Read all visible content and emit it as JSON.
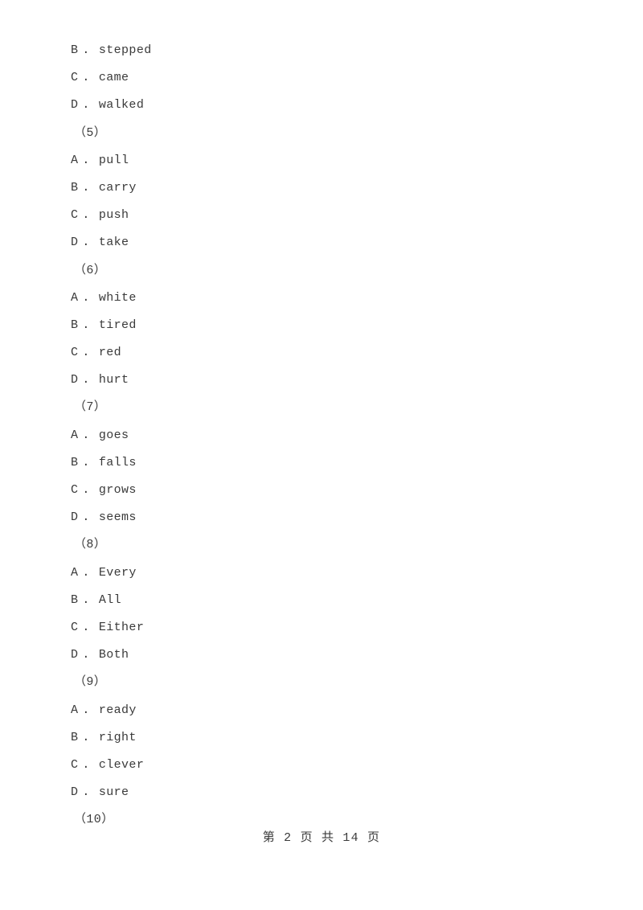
{
  "document": {
    "page_label": "第 2 页 共 14 页",
    "page_number": "2",
    "total_pages": "14",
    "text_color": "#3a3a3a",
    "background_color": "#ffffff"
  },
  "lines": [
    {
      "kind": "option",
      "letter": "B",
      "sep": ".",
      "text": "stepped"
    },
    {
      "kind": "option",
      "letter": "C",
      "sep": ".",
      "text": "came"
    },
    {
      "kind": "option",
      "letter": "D",
      "sep": ".",
      "text": "walked"
    },
    {
      "kind": "question",
      "label": "（5）"
    },
    {
      "kind": "option",
      "letter": "A",
      "sep": ".",
      "text": "pull"
    },
    {
      "kind": "option",
      "letter": "B",
      "sep": ".",
      "text": "carry"
    },
    {
      "kind": "option",
      "letter": "C",
      "sep": ".",
      "text": "push"
    },
    {
      "kind": "option",
      "letter": "D",
      "sep": ".",
      "text": "take"
    },
    {
      "kind": "question",
      "label": "（6）"
    },
    {
      "kind": "option",
      "letter": "A",
      "sep": ".",
      "text": "white"
    },
    {
      "kind": "option",
      "letter": "B",
      "sep": ".",
      "text": "tired"
    },
    {
      "kind": "option",
      "letter": "C",
      "sep": ".",
      "text": "red"
    },
    {
      "kind": "option",
      "letter": "D",
      "sep": ".",
      "text": "hurt"
    },
    {
      "kind": "question",
      "label": "（7）"
    },
    {
      "kind": "option",
      "letter": "A",
      "sep": ".",
      "text": "goes"
    },
    {
      "kind": "option",
      "letter": "B",
      "sep": ".",
      "text": "falls"
    },
    {
      "kind": "option",
      "letter": "C",
      "sep": ".",
      "text": "grows"
    },
    {
      "kind": "option",
      "letter": "D",
      "sep": ".",
      "text": "seems"
    },
    {
      "kind": "question",
      "label": "（8）"
    },
    {
      "kind": "option",
      "letter": "A",
      "sep": ".",
      "text": "Every"
    },
    {
      "kind": "option",
      "letter": "B",
      "sep": ".",
      "text": "All"
    },
    {
      "kind": "option",
      "letter": "C",
      "sep": ".",
      "text": "Either"
    },
    {
      "kind": "option",
      "letter": "D",
      "sep": ".",
      "text": "Both"
    },
    {
      "kind": "question",
      "label": "（9）"
    },
    {
      "kind": "option",
      "letter": "A",
      "sep": ".",
      "text": "ready"
    },
    {
      "kind": "option",
      "letter": "B",
      "sep": ".",
      "text": "right"
    },
    {
      "kind": "option",
      "letter": "C",
      "sep": ".",
      "text": "clever"
    },
    {
      "kind": "option",
      "letter": "D",
      "sep": ".",
      "text": "sure"
    },
    {
      "kind": "question",
      "label": "（10）"
    }
  ]
}
